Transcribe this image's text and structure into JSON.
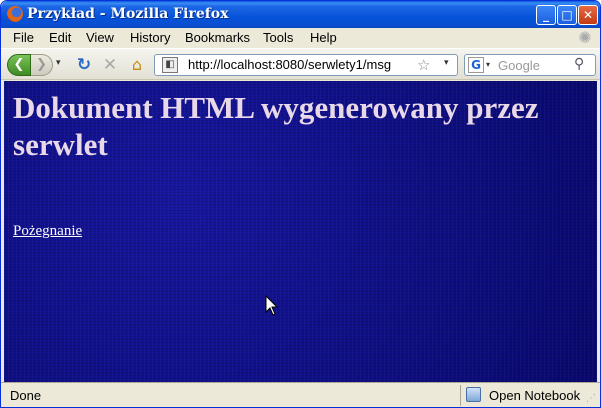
{
  "window": {
    "title": "Przykład - Mozilla Firefox",
    "minimize_label": "_",
    "maximize_label": "□",
    "close_label": "✕"
  },
  "menu": {
    "items": [
      "File",
      "Edit",
      "View",
      "History",
      "Bookmarks",
      "Tools",
      "Help"
    ]
  },
  "toolbar": {
    "back_glyph": "❮",
    "forward_glyph": "❯",
    "dropdown_glyph": "▾",
    "reload_glyph": "↻",
    "stop_glyph": "✕",
    "home_glyph": "⌂",
    "url": "http://localhost:8080/serwlety1/msg",
    "star_glyph": "☆",
    "search_engine_glyph": "G",
    "search_placeholder": "Google",
    "magnifier_glyph": "⚲"
  },
  "page": {
    "heading": "Dokument HTML wygenerowany przez serwlet",
    "link_text": "Pożegnanie",
    "background_color": "#0b0b8a",
    "heading_color": "#e8d8e8"
  },
  "status": {
    "text": "Done",
    "notebook_label": "Open Notebook"
  }
}
